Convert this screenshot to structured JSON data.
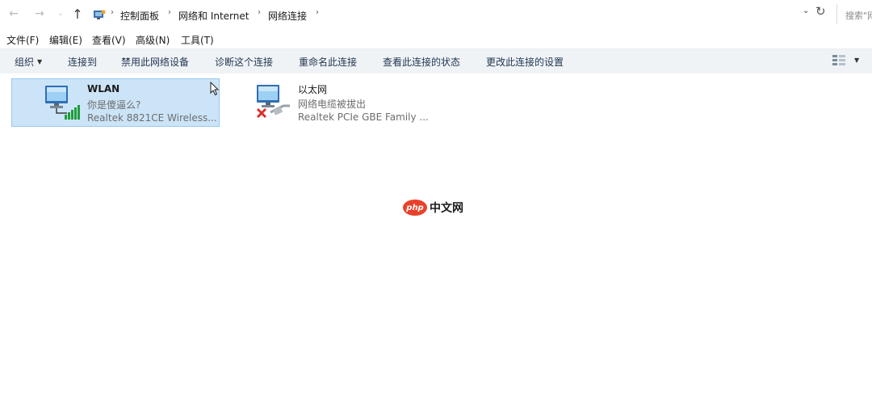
{
  "nav": {
    "back_icon": "back-arrow-icon",
    "forward_icon": "forward-arrow-icon",
    "recent_icon": "recent-locations-icon",
    "up_icon": "up-arrow-icon",
    "back_glyph": "←",
    "forward_glyph": "→",
    "recent_glyph": "⌄",
    "up_glyph": "↑"
  },
  "address": {
    "breadcrumbs": [
      "控制面板",
      "网络和 Internet",
      "网络连接"
    ],
    "separator": "›",
    "dropdown_glyph": "⌄",
    "refresh_glyph": "↻"
  },
  "search": {
    "placeholder": "搜索\"网"
  },
  "menu": {
    "items": [
      "文件(F)",
      "编辑(E)",
      "查看(V)",
      "高级(N)",
      "工具(T)"
    ]
  },
  "commands": {
    "organize": "组织",
    "items": [
      "连接到",
      "禁用此网络设备",
      "诊断这个连接",
      "重命名此连接",
      "查看此连接的状态",
      "更改此连接的设置"
    ],
    "dropdown_glyph": "▼"
  },
  "connections": [
    {
      "name": "WLAN",
      "status": "你是傻逼么?",
      "device": "Realtek 8821CE Wireless...",
      "icon": "wireless-network-adapter-icon",
      "selected": true
    },
    {
      "name": "以太网",
      "status": "网络电缆被拔出",
      "device": "Realtek PCIe GBE Family ...",
      "icon": "ethernet-adapter-disconnected-icon",
      "selected": false
    }
  ],
  "watermark": {
    "logo_text": "php",
    "text": "中文网"
  },
  "colors": {
    "selection_bg": "#cce4f7",
    "selection_border": "#99c9ef",
    "command_bar_bg": "#f0f3f6",
    "watermark_red": "#e8412a",
    "signal_green": "#1f9d3b",
    "disconnected_red": "#d9302c"
  }
}
